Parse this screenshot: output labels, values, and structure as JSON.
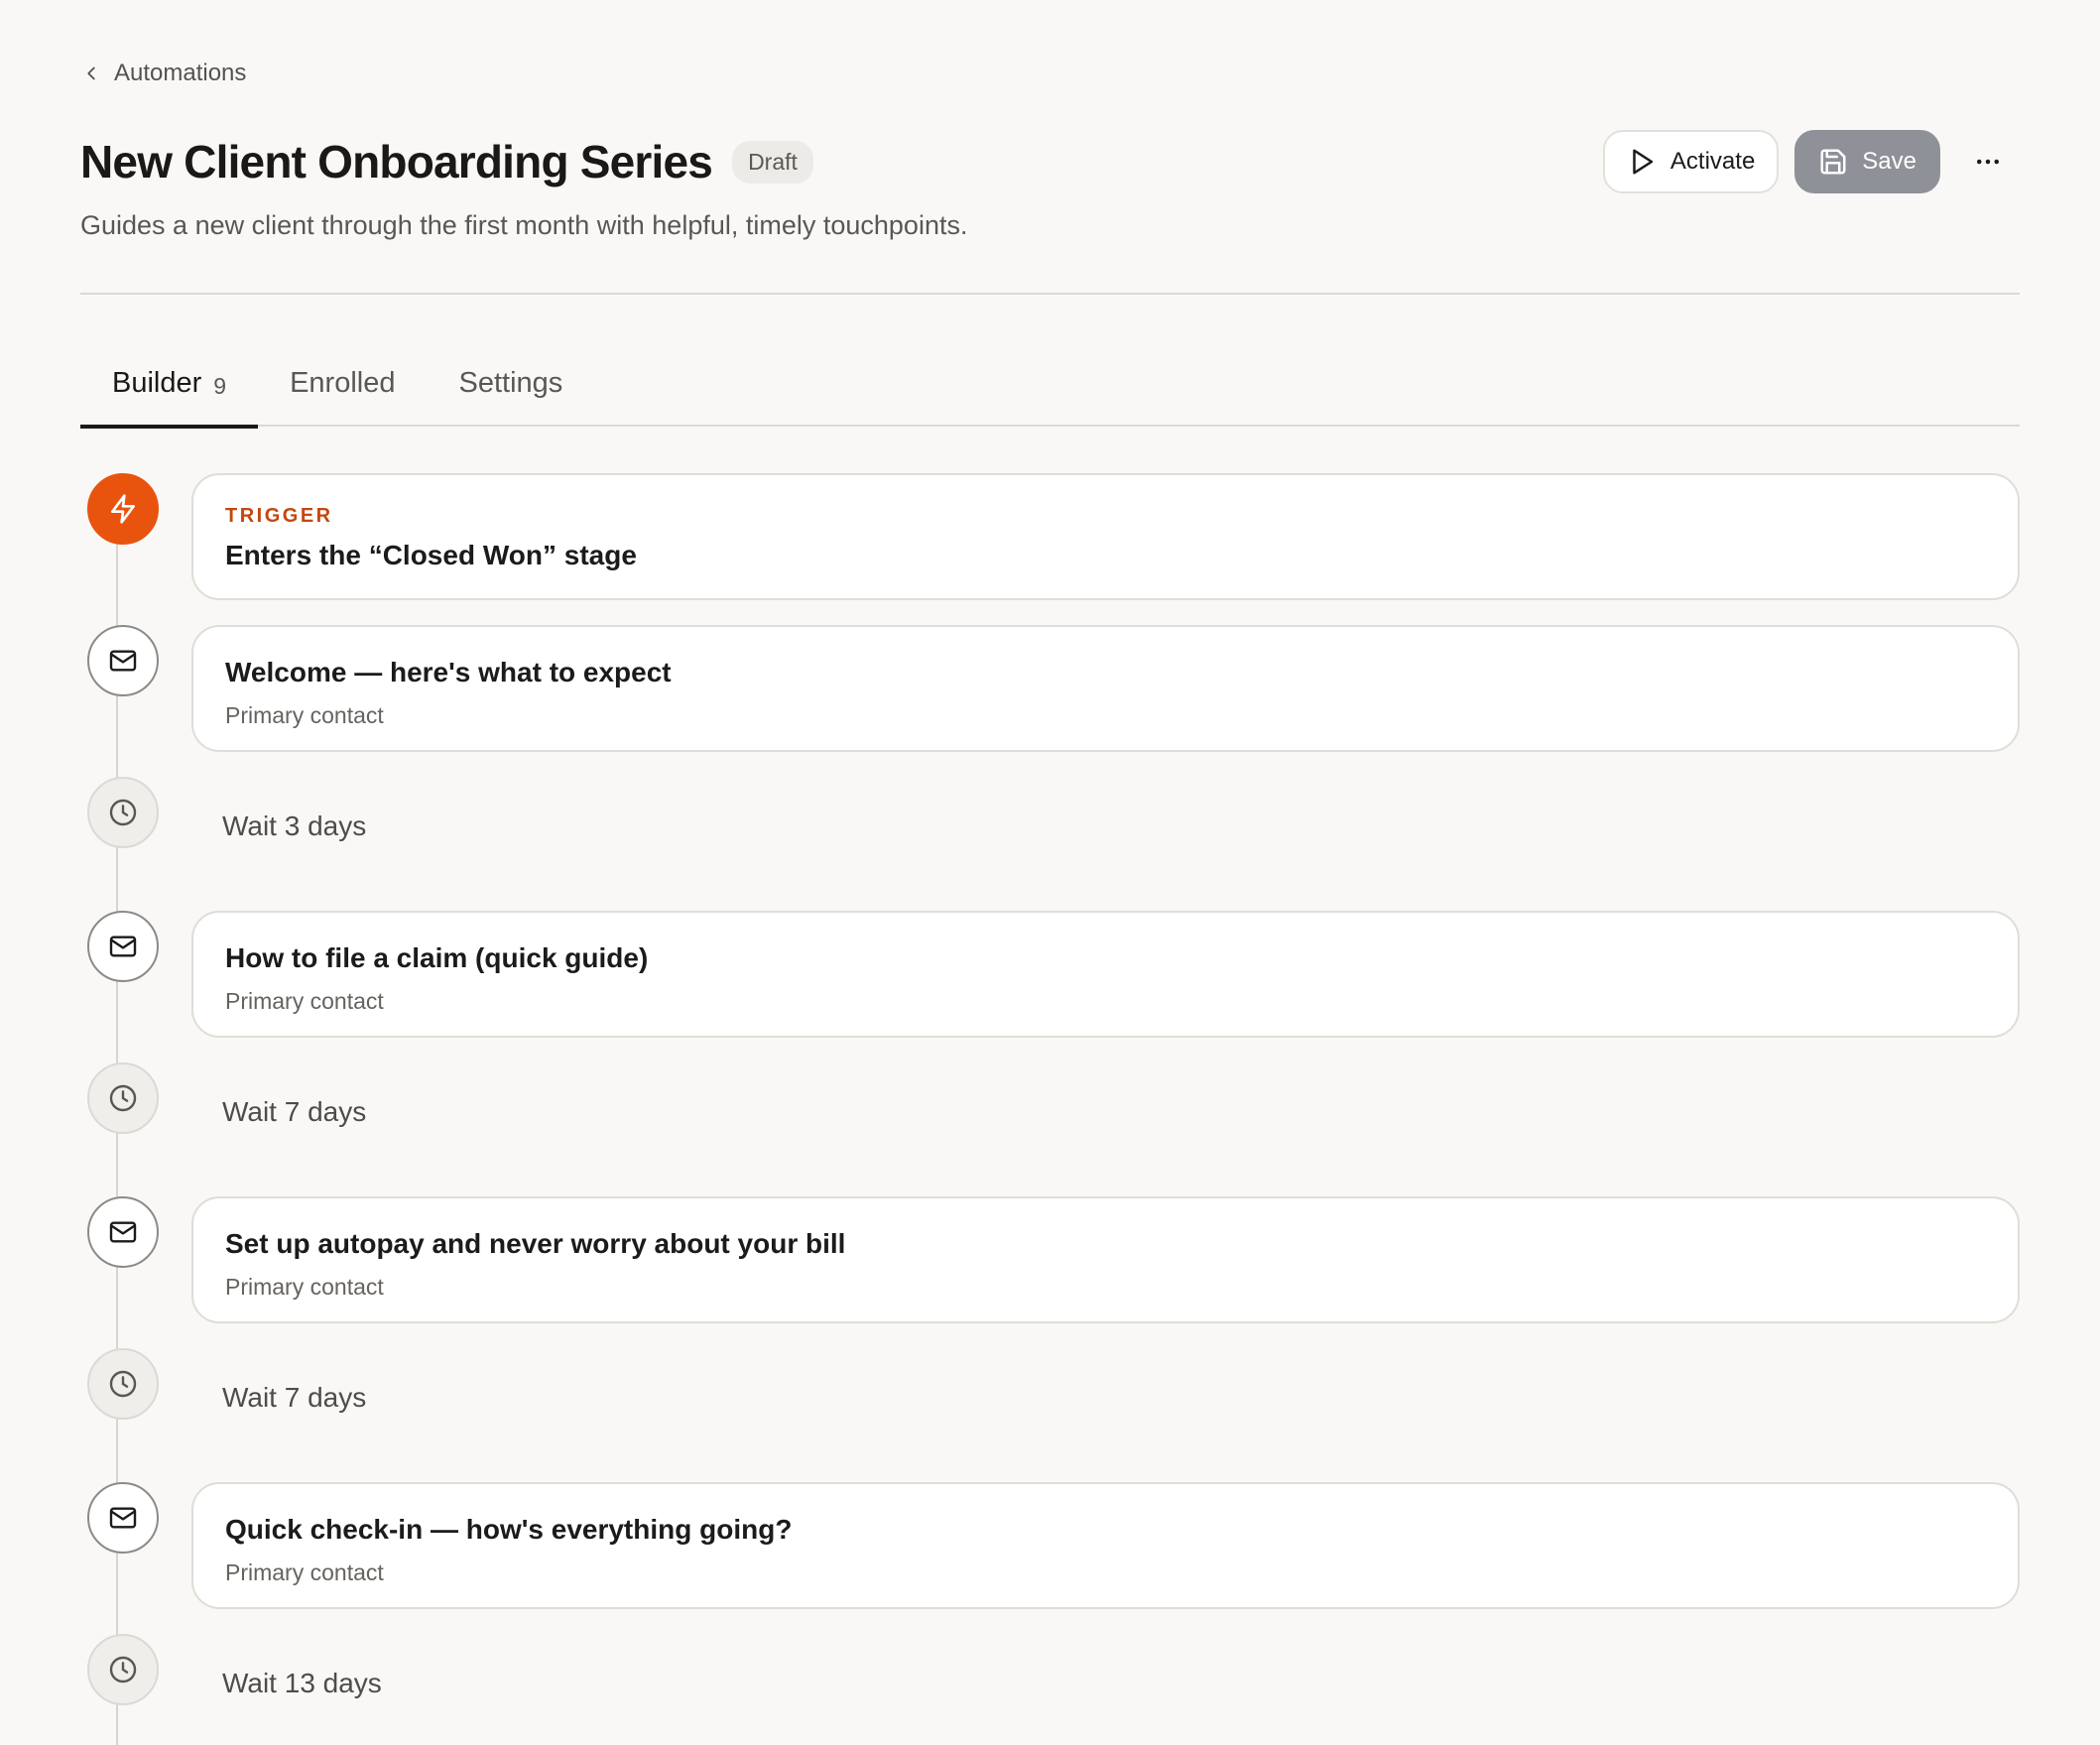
{
  "breadcrumb": {
    "label": "Automations"
  },
  "header": {
    "title": "New Client Onboarding Series",
    "status": "Draft",
    "subtitle": "Guides a new client through the first month with helpful, timely touchpoints."
  },
  "actions": {
    "activate_label": "Activate",
    "save_label": "Save"
  },
  "tabs": [
    {
      "label": "Builder",
      "count": "9",
      "active": true
    },
    {
      "label": "Enrolled"
    },
    {
      "label": "Settings"
    }
  ],
  "trigger": {
    "label": "TRIGGER",
    "text": "Enters the “Closed Won” stage"
  },
  "steps": [
    {
      "type": "email",
      "subject": "Welcome — here's what to expect",
      "recipient": "Primary contact"
    },
    {
      "type": "wait",
      "text": "Wait 3 days"
    },
    {
      "type": "email",
      "subject": "How to file a claim (quick guide)",
      "recipient": "Primary contact"
    },
    {
      "type": "wait",
      "text": "Wait 7 days"
    },
    {
      "type": "email",
      "subject": "Set up autopay and never worry about your bill",
      "recipient": "Primary contact"
    },
    {
      "type": "wait",
      "text": "Wait 7 days"
    },
    {
      "type": "email",
      "subject": "Quick check-in — how's everything going?",
      "recipient": "Primary contact"
    },
    {
      "type": "wait",
      "text": "Wait 13 days"
    }
  ],
  "colors": {
    "accent": "#e8540e",
    "trigger_label": "#c4470d",
    "save_button": "#8e9197",
    "background": "#f9f8f6"
  },
  "icons": {
    "back": "chevron-left-icon",
    "activate": "play-icon",
    "save": "floppy-disk-icon",
    "more": "more-horizontal-icon",
    "trigger": "lightning-bolt-icon",
    "email": "mail-icon",
    "wait": "clock-icon"
  }
}
